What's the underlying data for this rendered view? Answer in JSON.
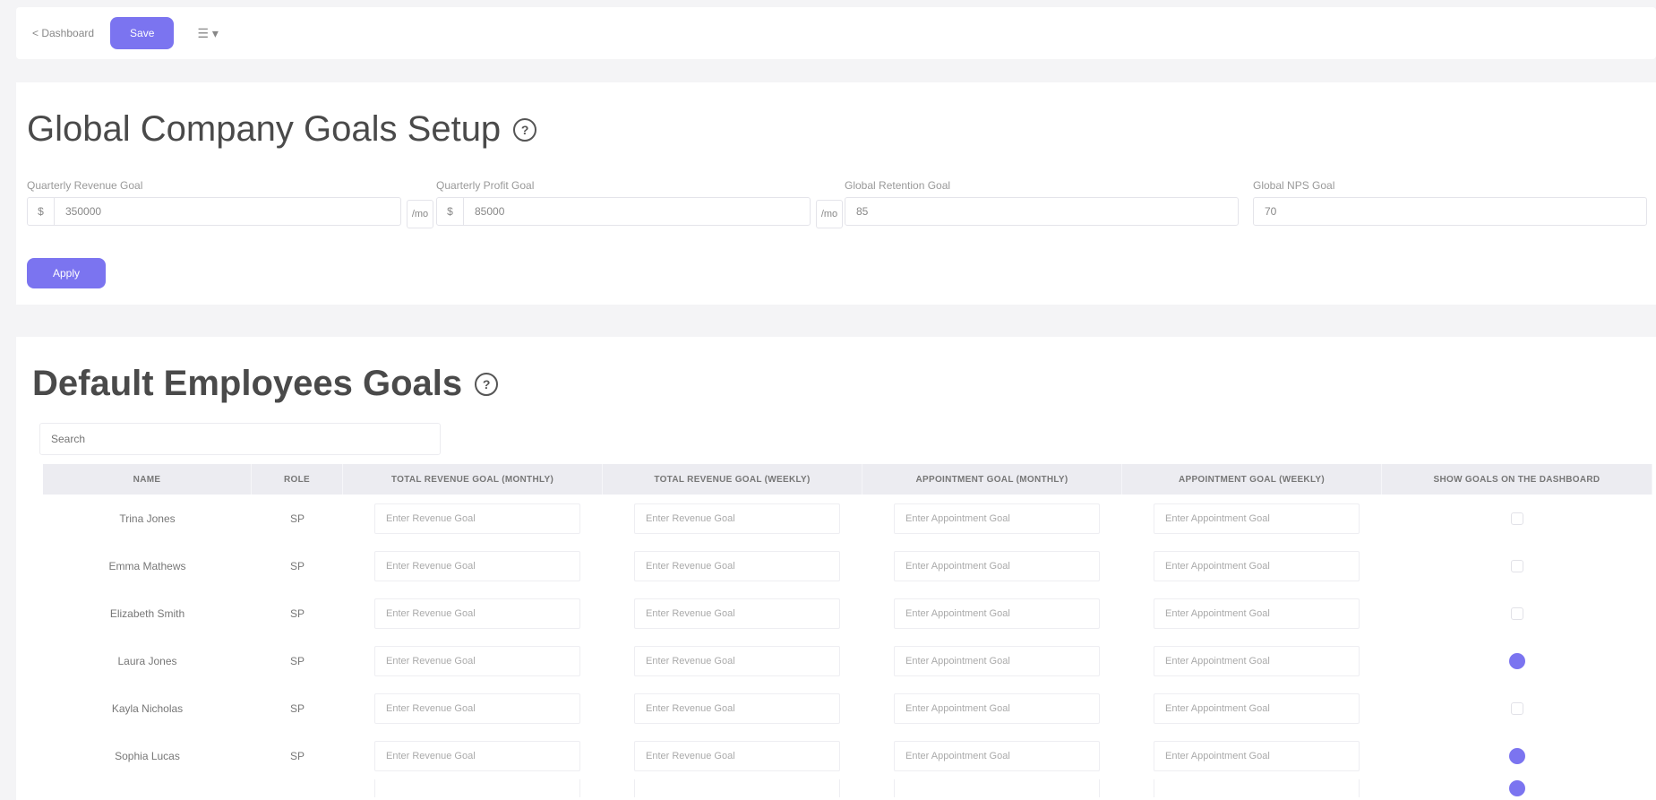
{
  "toolbar": {
    "back_label": "< Dashboard",
    "save_label": "Save",
    "more_label": "☰ ▾"
  },
  "company_goals": {
    "title": "Global Company Goals Setup",
    "fields": [
      {
        "label": "Quarterly Revenue Goal",
        "prefix": "$",
        "value": "350000",
        "side": "/mo"
      },
      {
        "label": "Quarterly Profit Goal",
        "prefix": "$",
        "value": "85000",
        "side": "/mo"
      },
      {
        "label": "Global Retention Goal",
        "value": "85"
      },
      {
        "label": "Global NPS Goal",
        "value": "70"
      }
    ],
    "apply_label": "Apply"
  },
  "employee_goals": {
    "title": "Default Employees Goals",
    "search_placeholder": "Search",
    "columns": [
      "NAME",
      "ROLE",
      "TOTAL REVENUE GOAL (MONTHLY)",
      "TOTAL REVENUE GOAL (WEEKLY)",
      "APPOINTMENT GOAL (MONTHLY)",
      "APPOINTMENT GOAL (WEEKLY)",
      "SHOW GOALS ON THE DASHBOARD"
    ],
    "rows": [
      {
        "name": "Trina Jones",
        "role": "SP",
        "rev_m": "Enter Revenue Goal",
        "rev_w": "Enter Revenue Goal",
        "appt_m": "Enter Appointment Goal",
        "appt_w": "Enter Appointment Goal",
        "show": false
      },
      {
        "name": "Emma Mathews",
        "role": "SP",
        "rev_m": "Enter Revenue Goal",
        "rev_w": "Enter Revenue Goal",
        "appt_m": "Enter Appointment Goal",
        "appt_w": "Enter Appointment Goal",
        "show": false
      },
      {
        "name": "Elizabeth Smith",
        "role": "SP",
        "rev_m": "Enter Revenue Goal",
        "rev_w": "Enter Revenue Goal",
        "appt_m": "Enter Appointment Goal",
        "appt_w": "Enter Appointment Goal",
        "show": false
      },
      {
        "name": "Laura Jones",
        "role": "SP",
        "rev_m": "Enter Revenue Goal",
        "rev_w": "Enter Revenue Goal",
        "appt_m": "Enter Appointment Goal",
        "appt_w": "Enter Appointment Goal",
        "show": true
      },
      {
        "name": "Kayla Nicholas",
        "role": "SP",
        "rev_m": "Enter Revenue Goal",
        "rev_w": "Enter Revenue Goal",
        "appt_m": "Enter Appointment Goal",
        "appt_w": "Enter Appointment Goal",
        "show": false
      },
      {
        "name": "Sophia Lucas",
        "role": "SP",
        "rev_m": "Enter Revenue Goal",
        "rev_w": "Enter Revenue Goal",
        "appt_m": "Enter Appointment Goal",
        "appt_w": "Enter Appointment Goal",
        "show": true
      },
      {
        "name": "",
        "role": "",
        "rev_m": "",
        "rev_w": "",
        "appt_m": "",
        "appt_w": "",
        "show": true
      }
    ]
  },
  "colors": {
    "accent": "#7b74f0",
    "background": "#f4f4f6",
    "header_bg": "#ececf1"
  }
}
